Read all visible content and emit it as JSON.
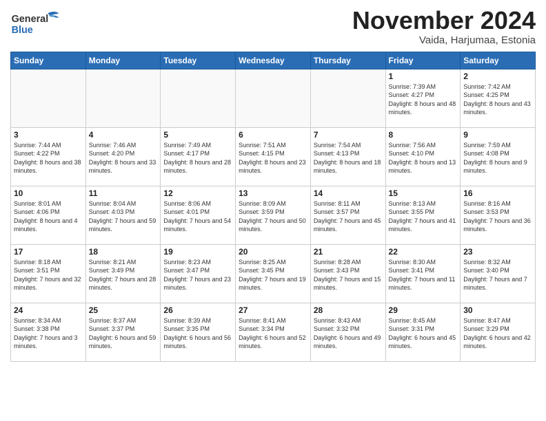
{
  "header": {
    "logo_general": "General",
    "logo_blue": "Blue",
    "month_title": "November 2024",
    "subtitle": "Vaida, Harjumaa, Estonia"
  },
  "weekdays": [
    "Sunday",
    "Monday",
    "Tuesday",
    "Wednesday",
    "Thursday",
    "Friday",
    "Saturday"
  ],
  "weeks": [
    [
      {
        "day": "",
        "sunrise": "",
        "sunset": "",
        "daylight": ""
      },
      {
        "day": "",
        "sunrise": "",
        "sunset": "",
        "daylight": ""
      },
      {
        "day": "",
        "sunrise": "",
        "sunset": "",
        "daylight": ""
      },
      {
        "day": "",
        "sunrise": "",
        "sunset": "",
        "daylight": ""
      },
      {
        "day": "",
        "sunrise": "",
        "sunset": "",
        "daylight": ""
      },
      {
        "day": "1",
        "sunrise": "Sunrise: 7:39 AM",
        "sunset": "Sunset: 4:27 PM",
        "daylight": "Daylight: 8 hours and 48 minutes."
      },
      {
        "day": "2",
        "sunrise": "Sunrise: 7:42 AM",
        "sunset": "Sunset: 4:25 PM",
        "daylight": "Daylight: 8 hours and 43 minutes."
      }
    ],
    [
      {
        "day": "3",
        "sunrise": "Sunrise: 7:44 AM",
        "sunset": "Sunset: 4:22 PM",
        "daylight": "Daylight: 8 hours and 38 minutes."
      },
      {
        "day": "4",
        "sunrise": "Sunrise: 7:46 AM",
        "sunset": "Sunset: 4:20 PM",
        "daylight": "Daylight: 8 hours and 33 minutes."
      },
      {
        "day": "5",
        "sunrise": "Sunrise: 7:49 AM",
        "sunset": "Sunset: 4:17 PM",
        "daylight": "Daylight: 8 hours and 28 minutes."
      },
      {
        "day": "6",
        "sunrise": "Sunrise: 7:51 AM",
        "sunset": "Sunset: 4:15 PM",
        "daylight": "Daylight: 8 hours and 23 minutes."
      },
      {
        "day": "7",
        "sunrise": "Sunrise: 7:54 AM",
        "sunset": "Sunset: 4:13 PM",
        "daylight": "Daylight: 8 hours and 18 minutes."
      },
      {
        "day": "8",
        "sunrise": "Sunrise: 7:56 AM",
        "sunset": "Sunset: 4:10 PM",
        "daylight": "Daylight: 8 hours and 13 minutes."
      },
      {
        "day": "9",
        "sunrise": "Sunrise: 7:59 AM",
        "sunset": "Sunset: 4:08 PM",
        "daylight": "Daylight: 8 hours and 9 minutes."
      }
    ],
    [
      {
        "day": "10",
        "sunrise": "Sunrise: 8:01 AM",
        "sunset": "Sunset: 4:06 PM",
        "daylight": "Daylight: 8 hours and 4 minutes."
      },
      {
        "day": "11",
        "sunrise": "Sunrise: 8:04 AM",
        "sunset": "Sunset: 4:03 PM",
        "daylight": "Daylight: 7 hours and 59 minutes."
      },
      {
        "day": "12",
        "sunrise": "Sunrise: 8:06 AM",
        "sunset": "Sunset: 4:01 PM",
        "daylight": "Daylight: 7 hours and 54 minutes."
      },
      {
        "day": "13",
        "sunrise": "Sunrise: 8:09 AM",
        "sunset": "Sunset: 3:59 PM",
        "daylight": "Daylight: 7 hours and 50 minutes."
      },
      {
        "day": "14",
        "sunrise": "Sunrise: 8:11 AM",
        "sunset": "Sunset: 3:57 PM",
        "daylight": "Daylight: 7 hours and 45 minutes."
      },
      {
        "day": "15",
        "sunrise": "Sunrise: 8:13 AM",
        "sunset": "Sunset: 3:55 PM",
        "daylight": "Daylight: 7 hours and 41 minutes."
      },
      {
        "day": "16",
        "sunrise": "Sunrise: 8:16 AM",
        "sunset": "Sunset: 3:53 PM",
        "daylight": "Daylight: 7 hours and 36 minutes."
      }
    ],
    [
      {
        "day": "17",
        "sunrise": "Sunrise: 8:18 AM",
        "sunset": "Sunset: 3:51 PM",
        "daylight": "Daylight: 7 hours and 32 minutes."
      },
      {
        "day": "18",
        "sunrise": "Sunrise: 8:21 AM",
        "sunset": "Sunset: 3:49 PM",
        "daylight": "Daylight: 7 hours and 28 minutes."
      },
      {
        "day": "19",
        "sunrise": "Sunrise: 8:23 AM",
        "sunset": "Sunset: 3:47 PM",
        "daylight": "Daylight: 7 hours and 23 minutes."
      },
      {
        "day": "20",
        "sunrise": "Sunrise: 8:25 AM",
        "sunset": "Sunset: 3:45 PM",
        "daylight": "Daylight: 7 hours and 19 minutes."
      },
      {
        "day": "21",
        "sunrise": "Sunrise: 8:28 AM",
        "sunset": "Sunset: 3:43 PM",
        "daylight": "Daylight: 7 hours and 15 minutes."
      },
      {
        "day": "22",
        "sunrise": "Sunrise: 8:30 AM",
        "sunset": "Sunset: 3:41 PM",
        "daylight": "Daylight: 7 hours and 11 minutes."
      },
      {
        "day": "23",
        "sunrise": "Sunrise: 8:32 AM",
        "sunset": "Sunset: 3:40 PM",
        "daylight": "Daylight: 7 hours and 7 minutes."
      }
    ],
    [
      {
        "day": "24",
        "sunrise": "Sunrise: 8:34 AM",
        "sunset": "Sunset: 3:38 PM",
        "daylight": "Daylight: 7 hours and 3 minutes."
      },
      {
        "day": "25",
        "sunrise": "Sunrise: 8:37 AM",
        "sunset": "Sunset: 3:37 PM",
        "daylight": "Daylight: 6 hours and 59 minutes."
      },
      {
        "day": "26",
        "sunrise": "Sunrise: 8:39 AM",
        "sunset": "Sunset: 3:35 PM",
        "daylight": "Daylight: 6 hours and 56 minutes."
      },
      {
        "day": "27",
        "sunrise": "Sunrise: 8:41 AM",
        "sunset": "Sunset: 3:34 PM",
        "daylight": "Daylight: 6 hours and 52 minutes."
      },
      {
        "day": "28",
        "sunrise": "Sunrise: 8:43 AM",
        "sunset": "Sunset: 3:32 PM",
        "daylight": "Daylight: 6 hours and 49 minutes."
      },
      {
        "day": "29",
        "sunrise": "Sunrise: 8:45 AM",
        "sunset": "Sunset: 3:31 PM",
        "daylight": "Daylight: 6 hours and 45 minutes."
      },
      {
        "day": "30",
        "sunrise": "Sunrise: 8:47 AM",
        "sunset": "Sunset: 3:29 PM",
        "daylight": "Daylight: 6 hours and 42 minutes."
      }
    ]
  ]
}
